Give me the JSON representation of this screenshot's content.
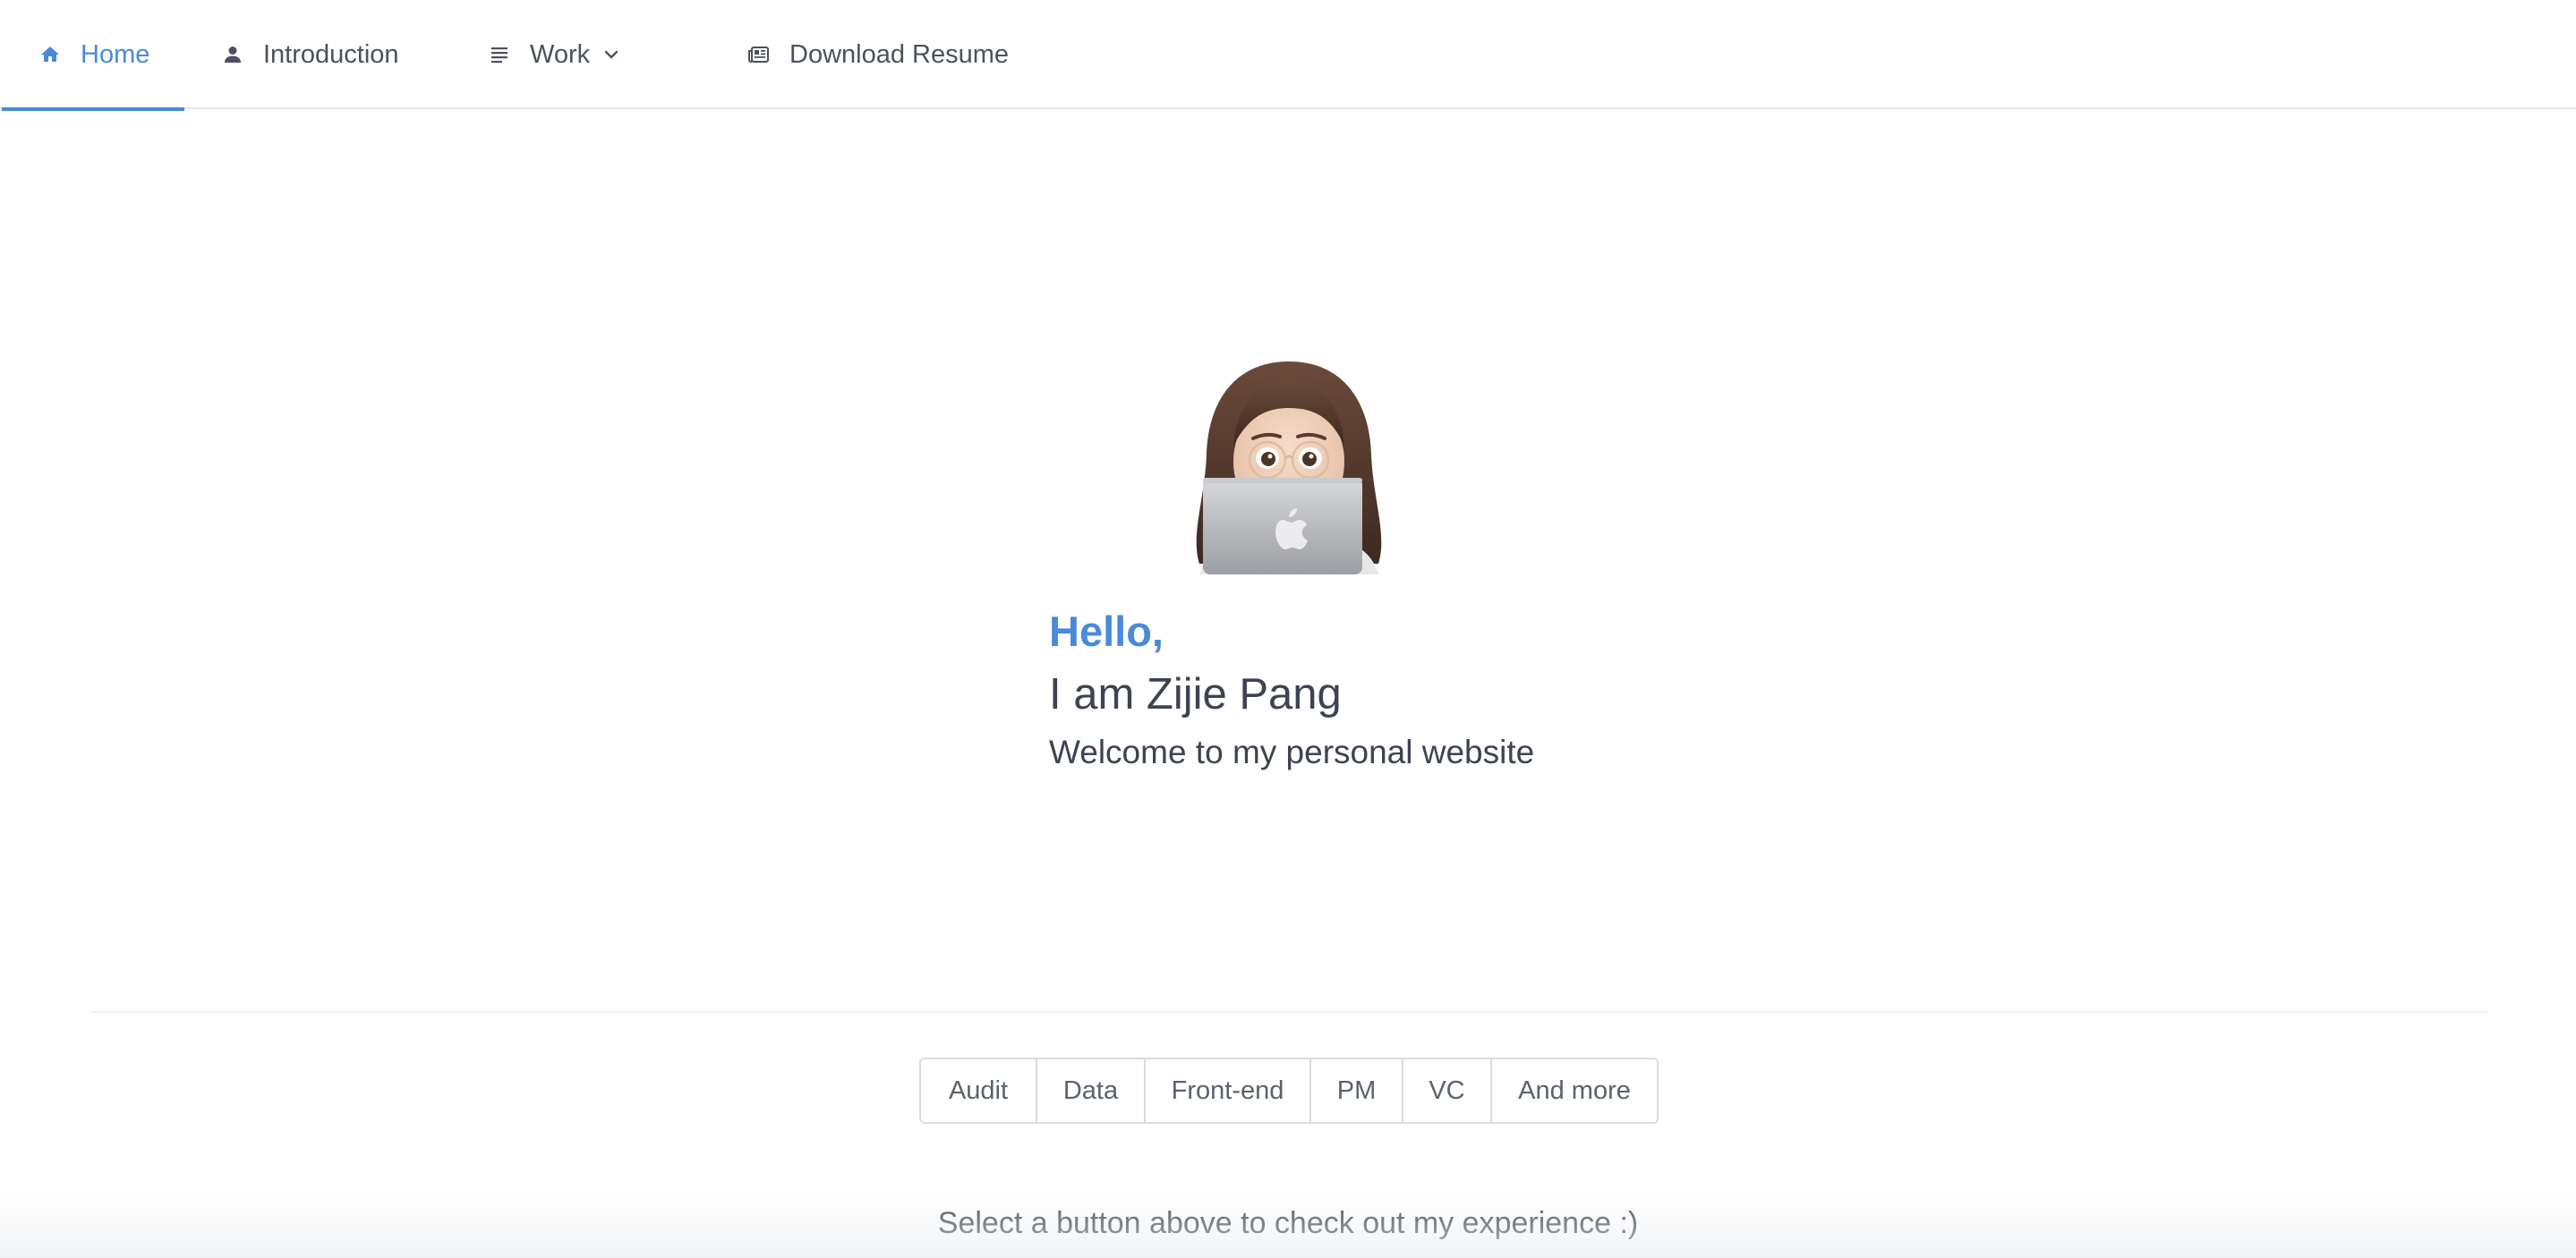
{
  "nav": {
    "items": [
      {
        "label": "Home",
        "icon": "home-icon",
        "active": true
      },
      {
        "label": "Introduction",
        "icon": "person-icon",
        "active": false
      },
      {
        "label": "Work",
        "icon": "list-icon",
        "active": false,
        "dropdown": true
      },
      {
        "label": "Download Resume",
        "icon": "newspaper-icon",
        "active": false
      }
    ]
  },
  "hero": {
    "greeting": "Hello,",
    "intro": "I am Zijie Pang",
    "welcome": "Welcome to my personal website",
    "avatar_icon": "memoji-avatar-laptop"
  },
  "experience": {
    "buttons": [
      "Audit",
      "Data",
      "Front-end",
      "PM",
      "VC",
      "And more"
    ],
    "hint": "Select a button above to check out my experience :)"
  },
  "colors": {
    "accent": "#4a8ad9",
    "text": "#3d4352",
    "border": "#d9dce1"
  }
}
